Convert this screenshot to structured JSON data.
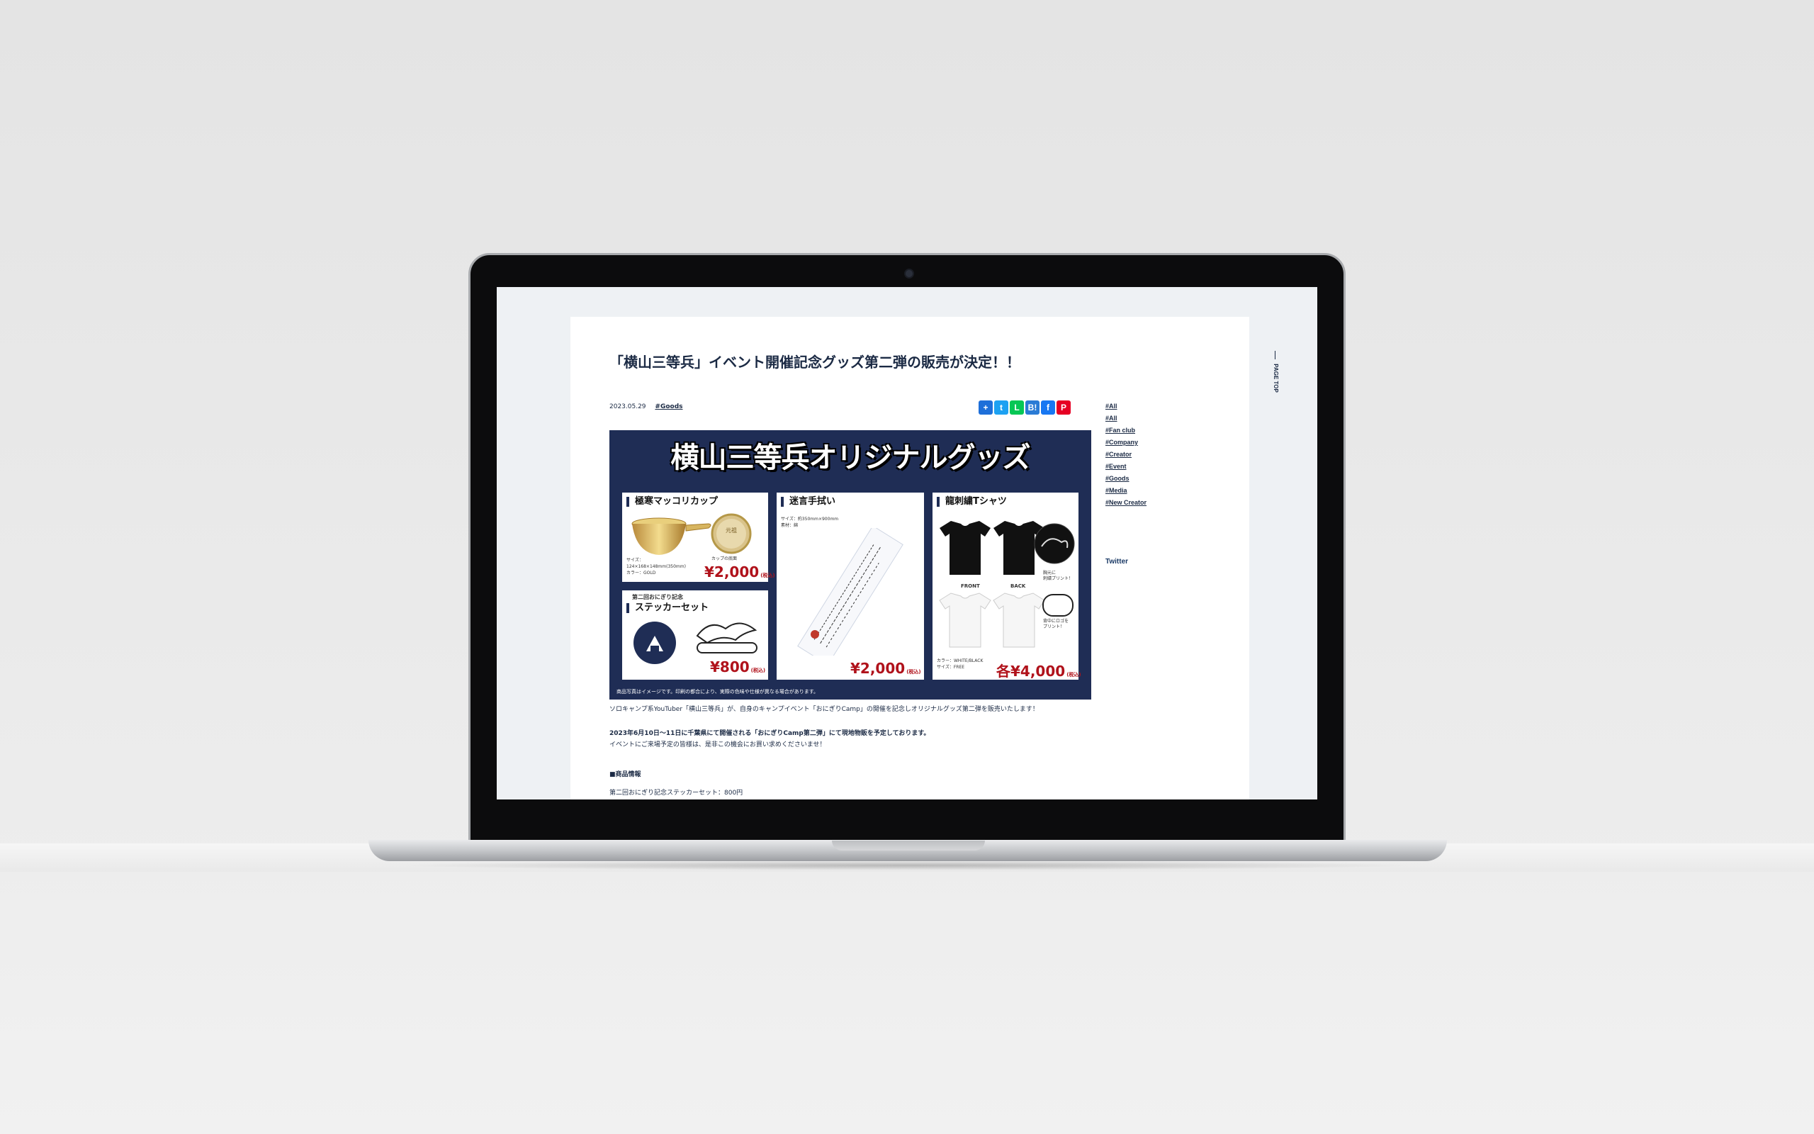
{
  "article": {
    "title": "「横山三等兵」イベント開催記念グッズ第二弾の販売が決定！！",
    "date": "2023.05.29",
    "tag": "#Goods",
    "paragraph1": "ソロキャンプ系YouTuber「横山三等兵」が、自身のキャンプイベント「おにぎりCamp」の開催を記念しオリジナルグッズ第二弾を販売いたします！",
    "paragraph2a": "2023年6月10日〜11日に千葉県にて開催される「おにぎりCamp第二弾」にて現地物販を予定しております。",
    "paragraph2b": "イベントにご来場予定の皆様は、是非この機会にお買い求めくださいませ！",
    "section_heading": "■商品情報",
    "item_line": "第二回おにぎり記念ステッカーセット：800円"
  },
  "share_buttons": [
    "+",
    "t",
    "L",
    "B!",
    "f",
    "P"
  ],
  "sidebar": {
    "tags": [
      "#All",
      "#All",
      "#Fan club",
      "#Company",
      "#Creator",
      "#Event",
      "#Goods",
      "#Media",
      "#New Creator"
    ],
    "twitter_label": "Twitter"
  },
  "page_top_label": "PAGE TOP",
  "banner": {
    "title": "横山三等兵オリジナルグッズ",
    "cup": {
      "heading": "極寒マッコリカップ",
      "size": "サイズ：",
      "size_value": "124×168×148mm(350mm)",
      "color": "カラー：GOLD",
      "badge_note": "カップの底面",
      "price": "¥2,000",
      "tax": "(税込)"
    },
    "towel": {
      "heading": "迷言手拭い",
      "size": "サイズ：約350mm×900mm",
      "material": "素材：綿",
      "price": "¥2,000",
      "tax": "(税込)"
    },
    "shirt": {
      "heading": "龍刺繍Tシャツ",
      "front": "FRONT",
      "back": "BACK",
      "chest_note1": "胸元に",
      "chest_note2": "刺繍プリント！",
      "back_note1": "背中にロゴを",
      "back_note2": "プリント！",
      "color": "カラー：WHITE/BLACK",
      "size": "サイズ：FREE",
      "price": "各¥4,000",
      "tax": "(税込)"
    },
    "sticker": {
      "subheading": "第二回おにぎり記念",
      "heading": "ステッカーセット",
      "price": "¥800",
      "tax": "(税込)"
    },
    "caption": "商品写真はイメージです。印刷の都合により、実際の色味や仕様が異なる場合があります。"
  },
  "colors": {
    "navy": "#1f2d55",
    "price_red": "#b0121b",
    "text": "#1b2a44"
  }
}
